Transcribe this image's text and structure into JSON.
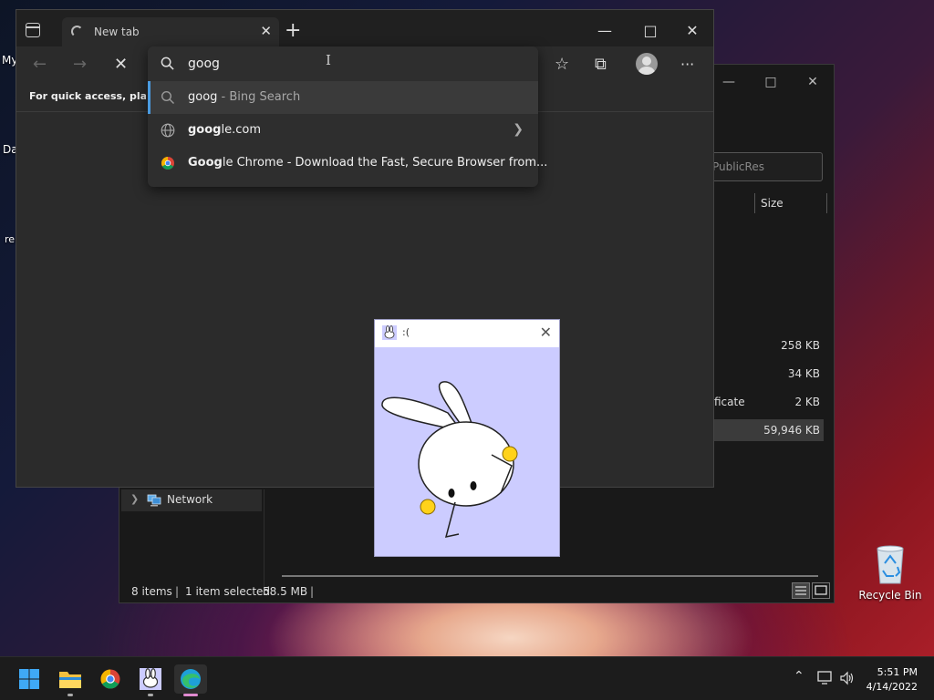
{
  "desktop": {
    "edge_texts": [
      "My",
      "Da",
      "ren"
    ],
    "recycle_bin_label": "Recycle Bin"
  },
  "explorer": {
    "search_placeholder": "PublicRes",
    "size_column": "Size",
    "rows": [
      {
        "name": "",
        "size": "258 KB"
      },
      {
        "name": "",
        "size": "34 KB"
      },
      {
        "name": "ficate",
        "size": "2 KB"
      },
      {
        "name": "",
        "size": "59,946 KB"
      }
    ],
    "nav_network": "Network",
    "status": {
      "items": "8 items",
      "selected": "1 item selected",
      "size": "58.5 MB"
    }
  },
  "edge": {
    "tab_title": "New tab",
    "favorites_hint": "For quick access, place y",
    "omnibox": {
      "value": "goog",
      "suggestions": [
        {
          "bold": "goog",
          "rest": " - Bing Search",
          "icon": "search-icon"
        },
        {
          "bold": "goog",
          "rest": "le.com",
          "icon": "globe-icon"
        },
        {
          "bold": "Goog",
          "rest": "le Chrome - Download the Fast, Secure Browser from...",
          "icon": "chrome-icon"
        }
      ]
    }
  },
  "bunny_window": {
    "title": ":("
  },
  "taskbar": {
    "time": "5:51 PM",
    "date": "4/14/2022"
  },
  "colors": {
    "accent": "#4a9be0",
    "active_indicator": "#e08ad0",
    "bunny_bg": "#ccccff"
  }
}
